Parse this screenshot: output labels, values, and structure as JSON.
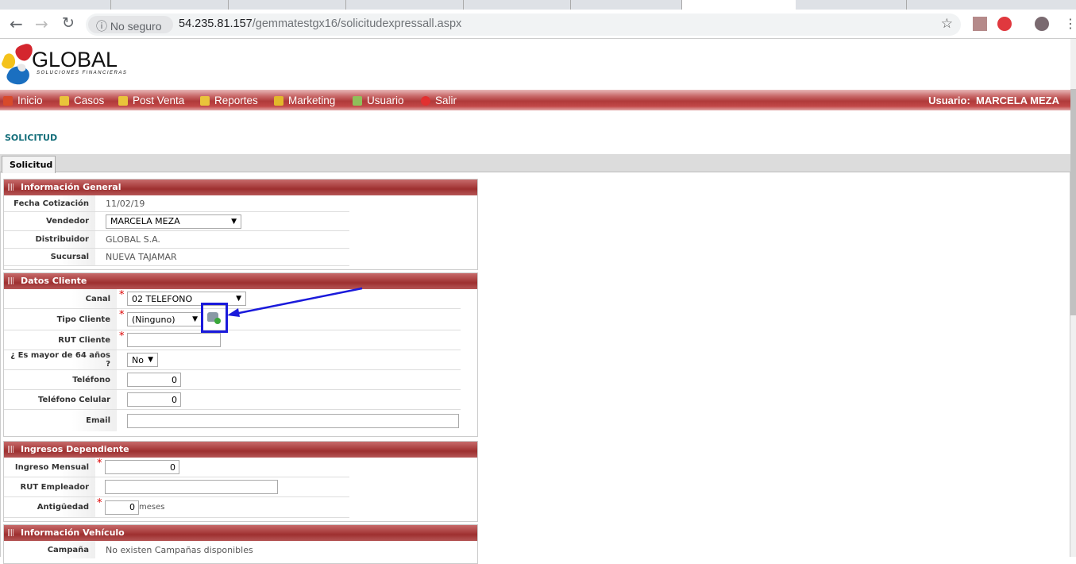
{
  "browser": {
    "security_label": "No seguro",
    "url_host": "54.235.81.157",
    "url_path": "/gemmatestgx16/solicitudexpressall.aspx"
  },
  "logo": {
    "name": "GLOBAL",
    "tagline": "SOLUCIONES FINANCIERAS"
  },
  "menu": {
    "items": [
      {
        "label": "Inicio",
        "icon": "home-icon",
        "color": "#d84a2a"
      },
      {
        "label": "Casos",
        "icon": "folder-icon",
        "color": "#e9c43a"
      },
      {
        "label": "Post Venta",
        "icon": "folder-icon",
        "color": "#e9c43a"
      },
      {
        "label": "Reportes",
        "icon": "folder-icon",
        "color": "#e9c43a"
      },
      {
        "label": "Marketing",
        "icon": "box-icon",
        "color": "#e2b82a"
      },
      {
        "label": "Usuario",
        "icon": "user-card-icon",
        "color": "#8fbf5a"
      },
      {
        "label": "Salir",
        "icon": "exit-icon",
        "color": "#e23030"
      }
    ],
    "user_label": "Usuario:",
    "user_name": "MARCELA MEZA"
  },
  "page": {
    "title": "SOLICITUD",
    "tab": "Solicitud"
  },
  "info_general": {
    "title": "Información General",
    "fecha_label": "Fecha Cotización",
    "fecha": "11/02/19",
    "vendedor_label": "Vendedor",
    "vendedor": "MARCELA MEZA",
    "distribuidor_label": "Distribuidor",
    "distribuidor": "GLOBAL S.A.",
    "sucursal_label": "Sucursal",
    "sucursal": "NUEVA TAJAMAR"
  },
  "datos_cliente": {
    "title": "Datos Cliente",
    "canal_label": "Canal",
    "canal": "02 TELEFONO",
    "tipo_label": "Tipo Cliente",
    "tipo": "(Ninguno)",
    "rut_label": "RUT Cliente",
    "rut": "",
    "mayor_label": "¿ Es mayor de 64 años ?",
    "mayor": "No",
    "telefono_label": "Teléfono",
    "telefono": "0",
    "celular_label": "Teléfono Celular",
    "celular": "0",
    "email_label": "Email",
    "email": ""
  },
  "ingresos": {
    "title": "Ingresos Dependiente",
    "ingreso_label": "Ingreso Mensual",
    "ingreso": "0",
    "rut_emp_label": "RUT Empleador",
    "rut_emp": "",
    "antig_label": "Antigüedad",
    "antig": "0",
    "antig_unit": "meses"
  },
  "vehiculo": {
    "title": "Información Vehículo",
    "campana_label": "Campaña",
    "campana": "No existen Campañas disponibles"
  },
  "annotation_color": "#1a1adb"
}
